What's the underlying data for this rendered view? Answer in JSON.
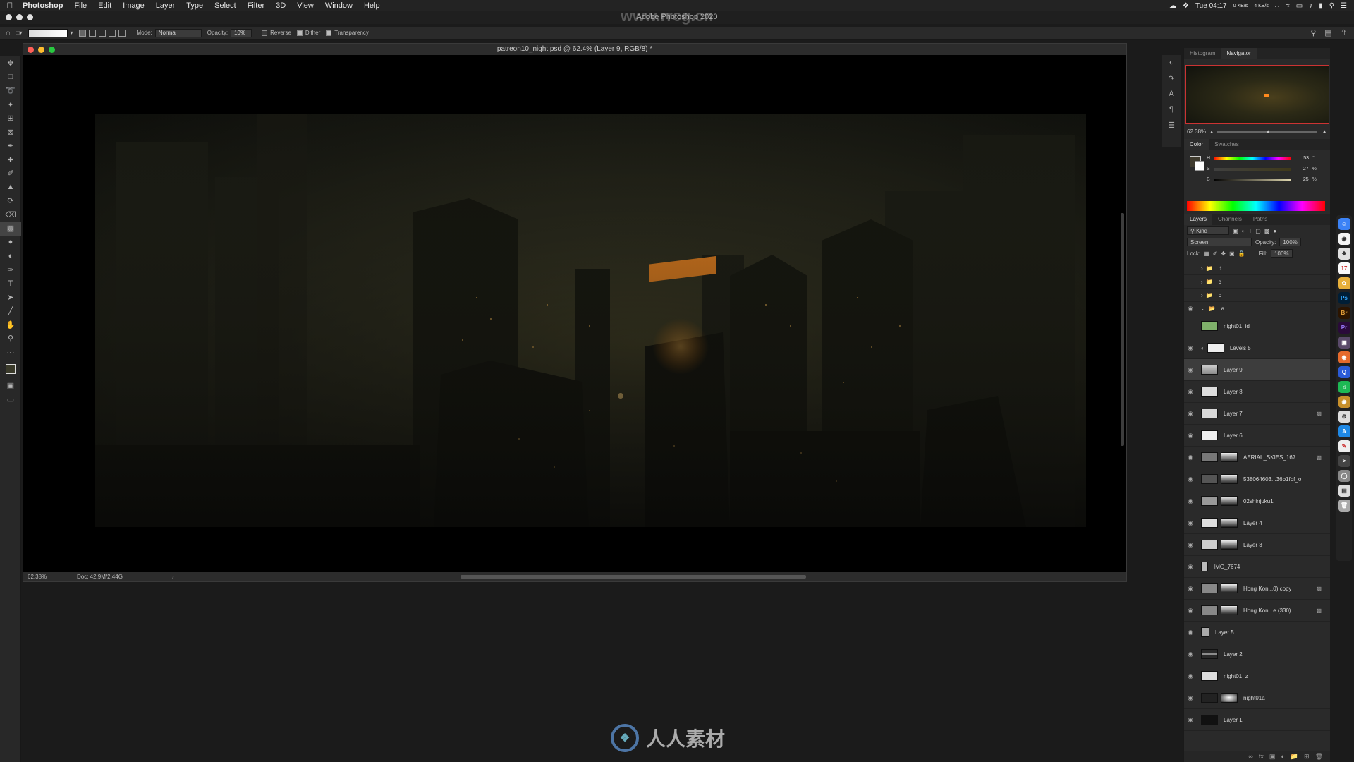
{
  "menubar": {
    "app_name": "Photoshop",
    "items": [
      "File",
      "Edit",
      "Image",
      "Layer",
      "Type",
      "Select",
      "Filter",
      "3D",
      "View",
      "Window",
      "Help"
    ],
    "clock": "Tue 04:17",
    "net_up": "0 KB/s",
    "net_down": "4 KB/s"
  },
  "app_window": {
    "title": "Adobe Photoshop 2020"
  },
  "options_bar": {
    "mode_label": "Mode:",
    "mode_value": "Normal",
    "opacity_label": "Opacity:",
    "opacity_value": "10%",
    "reverse_label": "Reverse",
    "dither_label": "Dither",
    "transparency_label": "Transparency"
  },
  "document": {
    "title": "patreon10_night.psd @ 62.4% (Layer 9, RGB/8) *",
    "zoom": "62.38%",
    "doc_size": "Doc: 42.9M/2.44G"
  },
  "navigator": {
    "tabs": [
      "Histogram",
      "Navigator"
    ],
    "active_tab": "Navigator",
    "zoom": "62.38%"
  },
  "color_panel": {
    "tabs": [
      "Color",
      "Swatches"
    ],
    "active_tab": "Color",
    "sliders": [
      {
        "channel": "H",
        "value": "53",
        "unit": "°"
      },
      {
        "channel": "S",
        "value": "27",
        "unit": "%"
      },
      {
        "channel": "B",
        "value": "25",
        "unit": "%"
      }
    ]
  },
  "layers_panel": {
    "tabs": [
      "Layers",
      "Channels",
      "Paths"
    ],
    "active_tab": "Layers",
    "filter_label": "Kind",
    "blend_mode": "Screen",
    "opacity_label": "Opacity:",
    "opacity_value": "100%",
    "lock_label": "Lock:",
    "fill_label": "Fill:",
    "fill_value": "100%",
    "groups": [
      "d",
      "c",
      "b",
      "a"
    ],
    "layers": [
      {
        "name": "night01_id",
        "visible": false,
        "fx": false,
        "selected": false
      },
      {
        "name": "Levels 5",
        "visible": true,
        "fx": false,
        "selected": false
      },
      {
        "name": "Layer 9",
        "visible": true,
        "fx": false,
        "selected": true
      },
      {
        "name": "Layer 8",
        "visible": true,
        "fx": false,
        "selected": false
      },
      {
        "name": "Layer 7",
        "visible": true,
        "fx": true,
        "selected": false
      },
      {
        "name": "Layer 6",
        "visible": true,
        "fx": false,
        "selected": false
      },
      {
        "name": "AERIAL_SKIES_167",
        "visible": true,
        "fx": true,
        "selected": false
      },
      {
        "name": "538064603...36b1fbf_o",
        "visible": true,
        "fx": false,
        "selected": false
      },
      {
        "name": "02shinjuku1",
        "visible": true,
        "fx": false,
        "selected": false
      },
      {
        "name": "Layer 4",
        "visible": true,
        "fx": false,
        "selected": false
      },
      {
        "name": "Layer 3",
        "visible": true,
        "fx": false,
        "selected": false
      },
      {
        "name": "IMG_7674",
        "visible": true,
        "fx": false,
        "selected": false
      },
      {
        "name": "Hong Kon...0) copy",
        "visible": true,
        "fx": true,
        "selected": false
      },
      {
        "name": "Hong Kon...e (330)",
        "visible": true,
        "fx": true,
        "selected": false
      },
      {
        "name": "Layer 5",
        "visible": true,
        "fx": false,
        "selected": false
      },
      {
        "name": "Layer 2",
        "visible": true,
        "fx": false,
        "selected": false
      },
      {
        "name": "night01_z",
        "visible": true,
        "fx": false,
        "selected": false
      },
      {
        "name": "night01a",
        "visible": true,
        "fx": false,
        "selected": false
      },
      {
        "name": "Layer 1",
        "visible": true,
        "fx": false,
        "selected": false
      }
    ]
  },
  "watermark": {
    "domain": "www.rrcg.cn",
    "brand": "人人素材"
  },
  "colors": {
    "nav_frame": "#cc3333",
    "selected_row": "#3d3d3d",
    "panel_bg": "#2a2a2a"
  }
}
